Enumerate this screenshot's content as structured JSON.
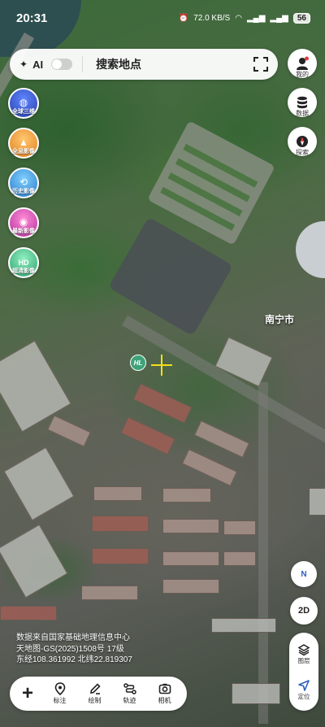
{
  "status": {
    "time": "20:31",
    "speed": "72.0 KB/S",
    "battery": "56"
  },
  "top": {
    "ai_label": "AI",
    "search_placeholder": "搜索地点"
  },
  "right_buttons": {
    "mine": "我的",
    "data": "数据",
    "explore": "探索"
  },
  "layers": [
    {
      "label": "全球三维",
      "color": "#3a5fd1"
    },
    {
      "label": "全息影像",
      "color": "#f3a23c"
    },
    {
      "label": "历史影像",
      "color": "#2f8fd6"
    },
    {
      "label": "最新影像",
      "color": "#d64fb5"
    },
    {
      "label": "超清影像",
      "color": "#4fbf8f"
    }
  ],
  "map": {
    "city_label": "南宁市",
    "poi_marker": "HL"
  },
  "info": {
    "line1": "数据来自国家基础地理信息中心",
    "line2": "天地图-GS(2025)1508号   17级",
    "line3": "东经108.361992  北纬22.819307"
  },
  "toolbar": {
    "annotate": "标注",
    "draw": "绘制",
    "track": "轨迹",
    "camera": "相机"
  },
  "controls": {
    "compass": "N",
    "view_mode": "2D",
    "layers": "图层",
    "locate": "定位"
  }
}
